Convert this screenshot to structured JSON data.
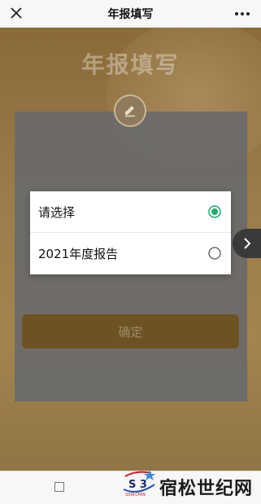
{
  "topbar": {
    "title": "年报填写",
    "close_icon": "close-icon",
    "more_icon": "more-icon"
  },
  "page": {
    "hero_title": "年报填写",
    "edit_icon": "pencil-icon",
    "confirm_label": "确定",
    "next_icon": "chevron-right-icon"
  },
  "dialog": {
    "options": [
      {
        "label": "请选择",
        "selected": true
      },
      {
        "label": "2021年度报告",
        "selected": false
      }
    ],
    "accent_color": "#1aad6e"
  },
  "bottom": {
    "tab_icon": "square-icon"
  },
  "watermark": {
    "text": "宿松世纪网",
    "logo_text": "SSW.CMW",
    "logo_letters": "S 3"
  }
}
